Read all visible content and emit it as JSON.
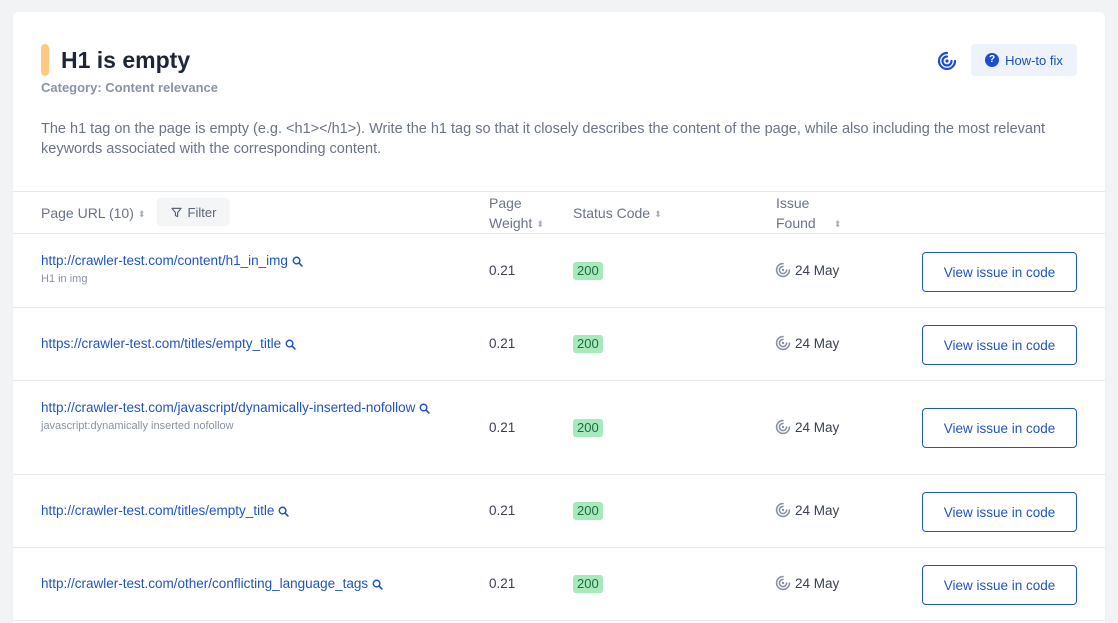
{
  "issue": {
    "title": "H1 is empty",
    "category": "Category: Content relevance",
    "description": "The h1 tag on the page is empty (e.g. <h1></h1>). Write the h1 tag so that it closely describes the content of the page, while also including the most relevant keywords associated with the corresponding content.",
    "howto_label": "How-to fix",
    "accent_color": "#ffc983"
  },
  "table": {
    "col_url": "Page URL (10)",
    "filter_label": "Filter",
    "col_weight_1": "Page",
    "col_weight_2": "Weight",
    "col_status": "Status Code",
    "col_issue_1": "Issue",
    "col_issue_2": "Found",
    "view_label": "View issue in code",
    "rows": [
      {
        "url": "http://crawler-test.com/content/h1_in_img",
        "subtitle": "H1 in img",
        "weight": "0.21",
        "status": "200",
        "date": "24 May"
      },
      {
        "url": "https://crawler-test.com/titles/empty_title",
        "subtitle": "",
        "weight": "0.21",
        "status": "200",
        "date": "24 May"
      },
      {
        "url": "http://crawler-test.com/javascript/dynamically-inserted-nofollow",
        "subtitle": "javascript:dynamically inserted nofollow",
        "weight": "0.21",
        "status": "200",
        "date": "24 May"
      },
      {
        "url": "http://crawler-test.com/titles/empty_title",
        "subtitle": "",
        "weight": "0.21",
        "status": "200",
        "date": "24 May"
      },
      {
        "url": "http://crawler-test.com/other/conflicting_language_tags",
        "subtitle": "",
        "weight": "0.21",
        "status": "200",
        "date": "24 May"
      }
    ]
  }
}
